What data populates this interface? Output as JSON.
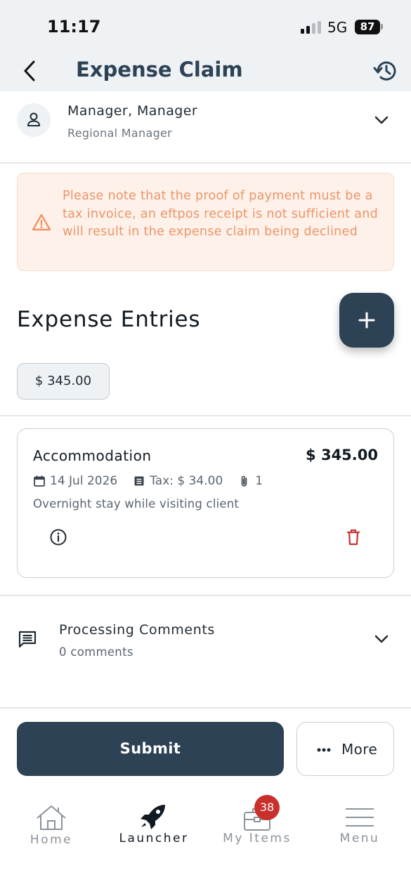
{
  "status_bar": {
    "time": "11:17",
    "network": "5G",
    "battery": "87"
  },
  "header": {
    "title": "Expense Claim",
    "back_icon": "chevron-left-icon",
    "history_icon": "history-icon"
  },
  "manager": {
    "name": "Manager, Manager",
    "role": "Regional Manager",
    "icon": "person-icon"
  },
  "notice": {
    "text": "Please note that the proof of payment must be a tax invoice, an eftpos receipt is not sufficient and will result in the expense claim being declined",
    "icon": "warning-icon",
    "color": "#ec9568",
    "background": "#fdf1ea"
  },
  "entries": {
    "title": "Expense Entries",
    "total": "$ 345.00",
    "items": [
      {
        "category": "Accommodation",
        "amount": "$ 345.00",
        "date": "14 Jul 2026",
        "tax": "Tax: $ 34.00",
        "attachments": "1",
        "description": "Overnight stay while visiting client"
      }
    ]
  },
  "comments": {
    "title": "Processing Comments",
    "count": "0 comments"
  },
  "actions": {
    "submit_label": "Submit",
    "more_label": "More"
  },
  "tabbar": {
    "tabs": [
      {
        "label": "Home",
        "icon": "home-icon"
      },
      {
        "label": "Launcher",
        "icon": "rocket-icon"
      },
      {
        "label": "My Items",
        "icon": "briefcase-icon",
        "badge": "38"
      },
      {
        "label": "Menu",
        "icon": "hamburger-icon"
      }
    ],
    "active": "Launcher"
  },
  "colors": {
    "primary": "#2d4255",
    "danger": "#c9302c",
    "header_bg": "#eef2f5"
  }
}
